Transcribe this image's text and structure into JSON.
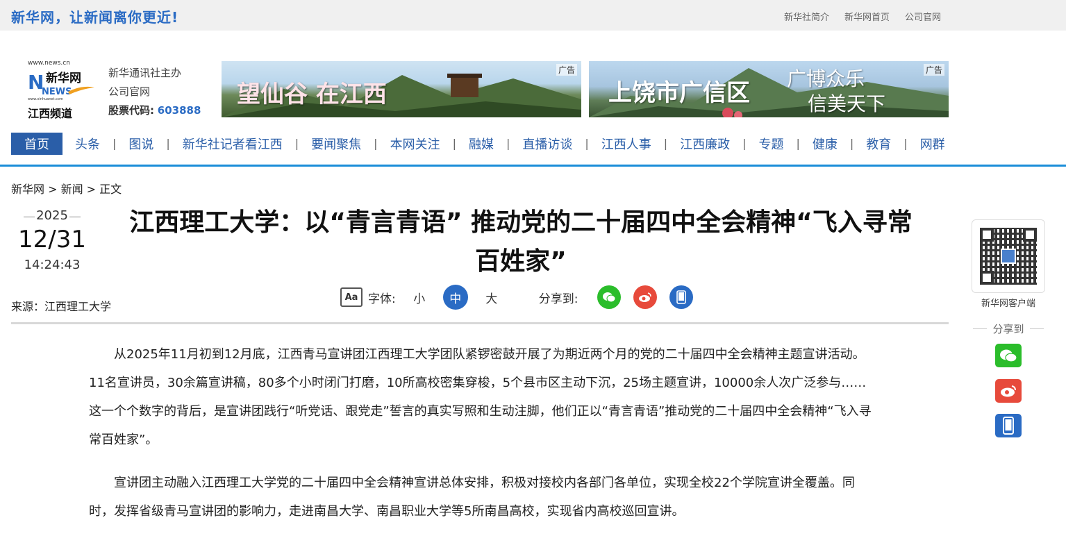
{
  "topbar": {
    "slogan": "新华网，让新闻离你更近!",
    "links": [
      "新华社简介",
      "新华网首页",
      "公司官网"
    ]
  },
  "header": {
    "logo_url": "www.news.cn",
    "logo_name": "新华网",
    "logo_news": "NEWS",
    "logo_subtext": "www.xinhuanet.com",
    "channel": "江西频道",
    "sponsor_line1": "新华通讯社主办",
    "sponsor_line2": "公司官网",
    "stock_label": "股票代码:",
    "stock_code": "603888"
  },
  "ads": [
    {
      "text": "望仙谷 在江西",
      "tag": "广告"
    },
    {
      "text": "上饶市广信区",
      "text2a": "广博众乐",
      "text2b": "信美天下",
      "tag": "广告"
    }
  ],
  "nav": {
    "items": [
      "首页",
      "头条",
      "图说",
      "新华社记者看江西",
      "要闻聚焦",
      "本网关注",
      "融媒",
      "直播访谈",
      "江西人事",
      "江西廉政",
      "专题",
      "健康",
      "教育",
      "网群"
    ],
    "separator": "|",
    "active_index": 0
  },
  "breadcrumb": "新华网 > 新闻 > 正文",
  "article_meta": {
    "year": "2025",
    "month_day": "12/31",
    "time": "14:24:43",
    "source": "来源：江西理工大学"
  },
  "article": {
    "title": "江西理工大学：以“青言青语” 推动党的二十届四中全会精神“飞入寻常百姓家”",
    "paragraphs": [
      "从2025年11月初到12月底，江西青马宣讲团江西理工大学团队紧锣密鼓开展了为期近两个月的党的二十届四中全会精神主题宣讲活动。11名宣讲员，30余篇宣讲稿，80多个小时闭门打磨，10所高校密集穿梭，5个县市区主动下沉，25场主题宣讲，10000余人次广泛参与……这一个个数字的背后，是宣讲团践行“听党话、跟党走”誓言的真实写照和生动注脚，他们正以“青言青语”推动党的二十届四中全会精神“飞入寻常百姓家”。",
      "宣讲团主动融入江西理工大学党的二十届四中全会精神宣讲总体安排，积极对接校内各部门各单位，实现全校22个学院宣讲全覆盖。同时，发挥省级青马宣讲团的影响力，走进南昌大学、南昌职业大学等5所南昌高校，实现省内高校巡回宣讲。"
    ]
  },
  "tools": {
    "font_icon": "Aa",
    "font_label": "字体:",
    "sizes": [
      "小",
      "中",
      "大"
    ],
    "active_size": 1,
    "share_label": "分享到:",
    "share_icons": [
      "wechat-icon",
      "weibo-icon",
      "phone-icon"
    ]
  },
  "side": {
    "qr_label": "新华网客户端",
    "share_label": "分享到"
  },
  "colors": {
    "brand_blue": "#2a5ea8",
    "nav_line": "#1a8dd8",
    "wechat": "#2bbd2b",
    "weibo": "#e74a3b",
    "phone": "#2a6bc4"
  }
}
